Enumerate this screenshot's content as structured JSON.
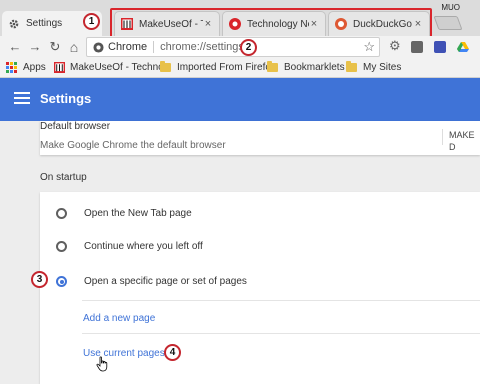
{
  "window": {
    "profile": "MUO"
  },
  "tabs": [
    {
      "label": "Settings",
      "icon": "gear-icon"
    },
    {
      "label": "MakeUseOf - Te",
      "icon": "makeuseof-icon"
    },
    {
      "label": "Technology New",
      "icon": "red-circle-icon"
    },
    {
      "label": "DuckDuckGo —",
      "icon": "duckduckgo-icon"
    }
  ],
  "toolbar": {
    "site_chip": "Chrome",
    "url": "chrome://settings"
  },
  "bookmarks": [
    {
      "label": "Apps"
    },
    {
      "label": "MakeUseOf - Techno"
    },
    {
      "label": "Imported From Firefc"
    },
    {
      "label": "Bookmarklets"
    },
    {
      "label": "My Sites"
    }
  ],
  "settings": {
    "title": "Settings",
    "default_browser": {
      "title": "Default browser",
      "description": "Make Google Chrome the default browser",
      "button": "MAKE D"
    },
    "on_startup": {
      "label": "On startup",
      "options": [
        {
          "label": "Open the New Tab page",
          "selected": false
        },
        {
          "label": "Continue where you left off",
          "selected": false
        },
        {
          "label": "Open a specific page or set of pages",
          "selected": true
        }
      ],
      "add_page": "Add a new page",
      "use_current": "Use current pages"
    }
  },
  "callouts": [
    "1",
    "2",
    "3",
    "4"
  ],
  "colors": {
    "accent": "#3f73d7",
    "callout_red": "#d9252b"
  }
}
